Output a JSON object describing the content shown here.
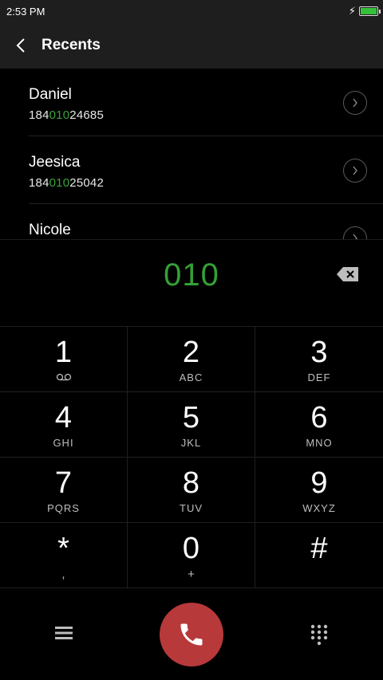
{
  "status_bar": {
    "time": "2:53 PM",
    "battery_level": 1.0
  },
  "app_bar": {
    "title": "Recents"
  },
  "recents": [
    {
      "name": "Daniel",
      "number_prefix": "184",
      "number_match": "010",
      "number_suffix": "24685"
    },
    {
      "name": "Jeesica",
      "number_prefix": "184",
      "number_match": "010",
      "number_suffix": "25042"
    },
    {
      "name": "Nicole"
    }
  ],
  "dialer": {
    "number": "010",
    "keys": [
      {
        "digit": "1",
        "letters": ""
      },
      {
        "digit": "2",
        "letters": "ABC"
      },
      {
        "digit": "3",
        "letters": "DEF"
      },
      {
        "digit": "4",
        "letters": "GHI"
      },
      {
        "digit": "5",
        "letters": "JKL"
      },
      {
        "digit": "6",
        "letters": "MNO"
      },
      {
        "digit": "7",
        "letters": "PQRS"
      },
      {
        "digit": "8",
        "letters": "TUV"
      },
      {
        "digit": "9",
        "letters": "WXYZ"
      },
      {
        "digit": "*",
        "letters": ","
      },
      {
        "digit": "0",
        "letters": "+"
      },
      {
        "digit": "#",
        "letters": ""
      }
    ]
  },
  "colors": {
    "match": "#3aa33c",
    "call_button": "#b8393a",
    "battery": "#35c23a"
  },
  "icons": {
    "back": "back-arrow-icon",
    "detail": "chevron-right-icon",
    "backspace": "backspace-icon",
    "voicemail": "voicemail-icon",
    "menu": "menu-icon",
    "call": "phone-icon",
    "dialpad": "dialpad-icon"
  }
}
